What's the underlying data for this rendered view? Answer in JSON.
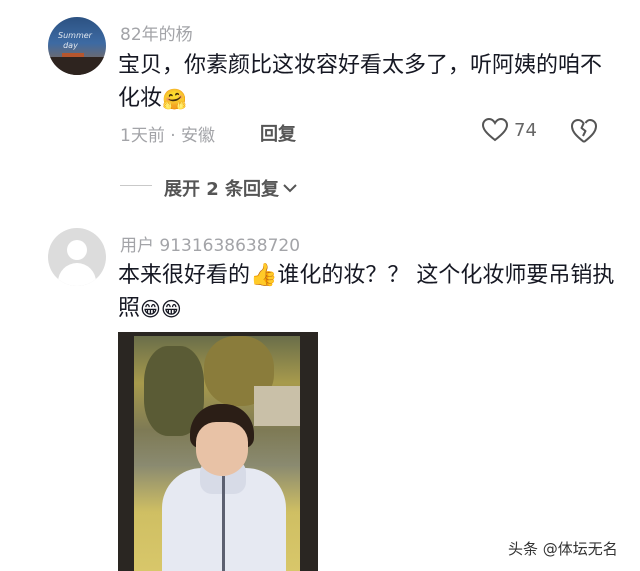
{
  "comments": [
    {
      "username": "82年的杨",
      "text": "宝贝，你素颜比这妆容好看太多了，听阿姨的咱不化妆",
      "emoji": "🤗",
      "meta": "1天前 · 安徽",
      "reply_label": "回复",
      "likes": "74",
      "expand_label": "展开 2 条回复"
    },
    {
      "username": "用户 9131638638720",
      "text": "本来很好看的👍谁化的妆？？ 这个化妆师要吊销执照",
      "emoji": "😁😁"
    }
  ],
  "watermark": "头条 @体坛无名"
}
